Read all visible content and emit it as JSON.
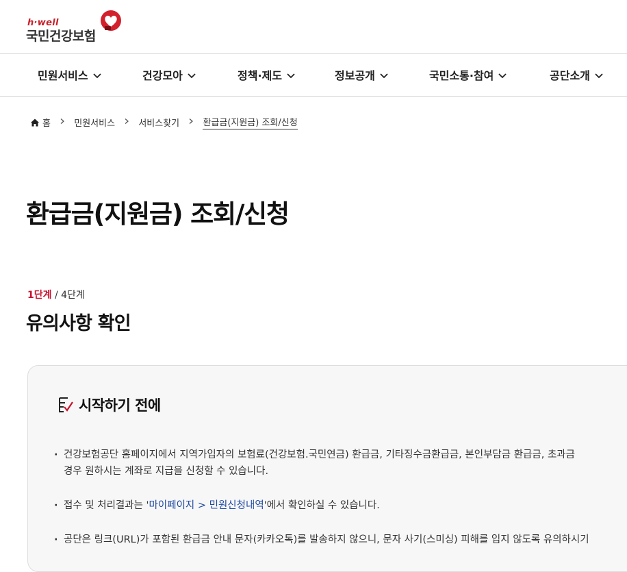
{
  "header": {
    "logo_sub": "h·well",
    "logo_main": "국민건강보험"
  },
  "gnb": {
    "items": [
      {
        "label": "민원서비스"
      },
      {
        "label": "건강모아"
      },
      {
        "label": "정책·제도"
      },
      {
        "label": "정보공개"
      },
      {
        "label": "국민소통·참여"
      },
      {
        "label": "공단소개"
      }
    ]
  },
  "breadcrumb": {
    "home": "홈",
    "items": [
      "민원서비스",
      "서비스찾기",
      "환급금(지원금) 조회/신청"
    ]
  },
  "page": {
    "title": "환급금(지원금) 조회/신청",
    "step_current": "1단계",
    "step_total": " / 4단계",
    "step_title": "유의사항 확인"
  },
  "notice": {
    "title": "시작하기 전에",
    "items": [
      {
        "line1": "건강보험공단 홈페이지에서 지역가입자의 보험료(건강보험.국민연금) 환급금, 기타징수금환급금, 본인부담금 환급금, 초과금",
        "line2": "경우 원하시는 계좌로 지급을 신청할 수 있습니다."
      },
      {
        "pre": "접수 및 처리결과는 '",
        "link": "마이페이지 > 민원신청내역",
        "post": "'에서 확인하실 수 있습니다."
      },
      {
        "line1": "공단은 링크(URL)가 포함된 환급금 안내 문자(카카오톡)를 발송하지 않으니, 문자 사기(스미싱) 피해를 입지 않도록 유의하시기"
      }
    ]
  },
  "colors": {
    "brand_red": "#c8102e",
    "link_blue": "#1e4aa0",
    "panel_bg": "#f7f7f7"
  }
}
